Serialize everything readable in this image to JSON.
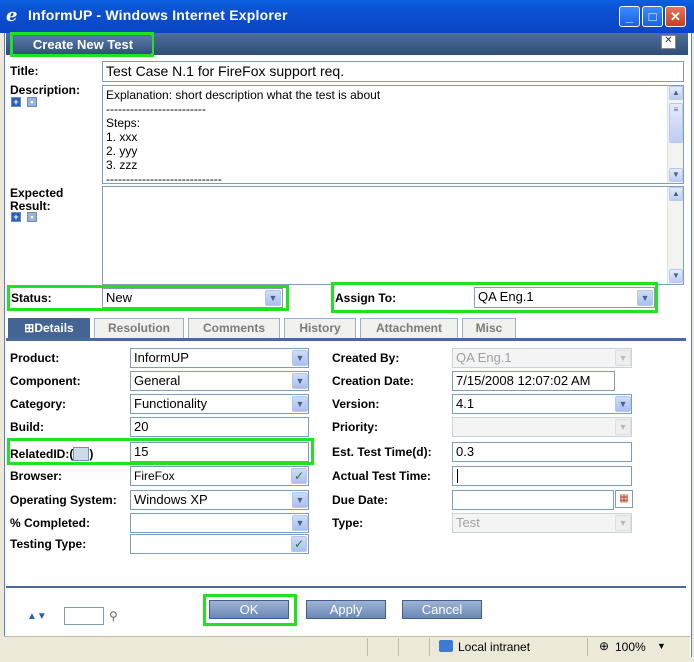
{
  "window": {
    "title": "InformUP - Windows Internet Explorer",
    "icon": "ie-logo-icon"
  },
  "header": {
    "create_button": "Create New Test"
  },
  "form": {
    "title_label": "Title:",
    "title_value": "Test Case N.1 for FireFox support req.",
    "description_label": "Description:",
    "description_value": "Explanation: short description what the test is about\n-------------------------\nSteps:\n1. xxx\n2. yyy\n3. zzz\n-----------------------------",
    "expected_label_1": "Expected",
    "expected_label_2": "Result:",
    "expected_value": "",
    "status_label": "Status:",
    "status_value": "New",
    "assign_label": "Assign To:",
    "assign_value": "QA Eng.1"
  },
  "tabs": [
    "Details",
    "Resolution",
    "Comments",
    "History",
    "Attachment",
    "Misc"
  ],
  "details": {
    "left": {
      "product_label": "Product:",
      "product_value": "InformUP",
      "component_label": "Component:",
      "component_value": "General",
      "category_label": "Category:",
      "category_value": "Functionality",
      "build_label": "Build:",
      "build_value": "20",
      "related_label_a": "RelatedID:(",
      "related_label_b": ")",
      "related_value": "15",
      "browser_label": "Browser:",
      "browser_value": "FireFox",
      "os_label": "Operating System:",
      "os_value": "Windows XP",
      "completed_label": "% Completed:",
      "completed_value": "",
      "testing_type_label": "Testing Type:",
      "testing_type_value": ""
    },
    "right": {
      "created_by_label": "Created By:",
      "created_by_value": "QA Eng.1",
      "creation_date_label": "Creation Date:",
      "creation_date_value": "7/15/2008 12:07:02 AM",
      "version_label": "Version:",
      "version_value": "4.1",
      "priority_label": "Priority:",
      "priority_value": "",
      "est_time_label": "Est. Test Time(d):",
      "est_time_value": "0.3",
      "actual_time_label": "Actual Test Time:",
      "actual_time_value": "",
      "due_date_label": "Due Date:",
      "due_date_value": "",
      "type_label": "Type:",
      "type_value": "Test"
    }
  },
  "buttons": {
    "ok": "OK",
    "apply": "Apply",
    "cancel": "Cancel"
  },
  "statusbar": {
    "zone": "Local intranet",
    "zoom": "100%"
  },
  "colors": {
    "highlight": "#22e022",
    "header": "#3a5a88"
  }
}
